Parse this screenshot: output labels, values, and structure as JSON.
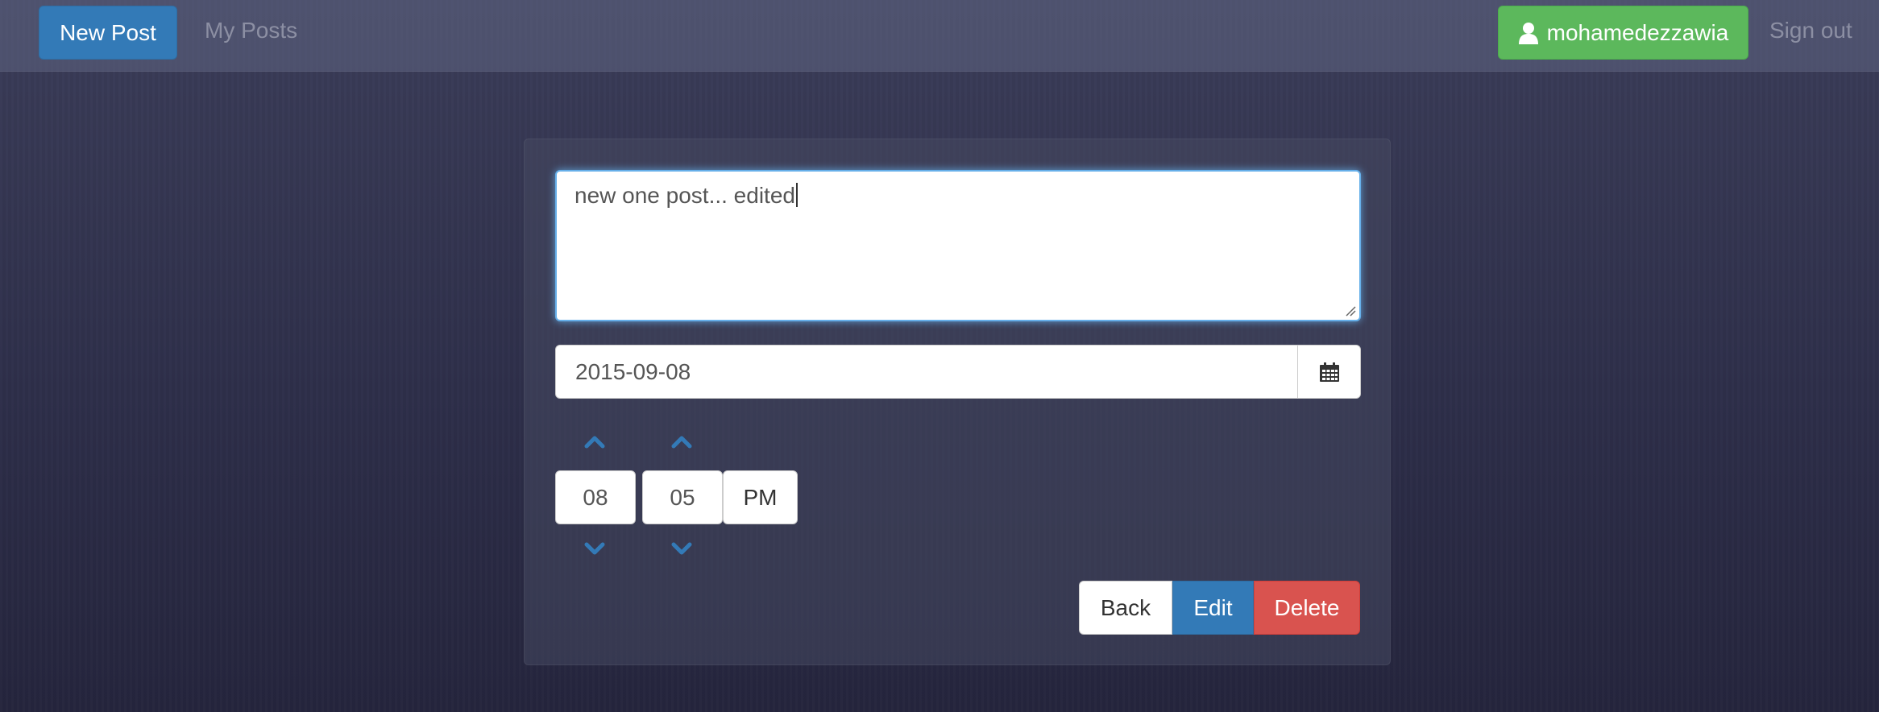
{
  "navbar": {
    "new_post_label": "New Post",
    "my_posts_label": "My Posts",
    "username": "mohamedezzawia",
    "sign_out_label": "Sign out"
  },
  "form": {
    "post_text": "new one post... edited",
    "date_value": "2015-09-08",
    "hour": "08",
    "minute": "05",
    "meridian": "PM"
  },
  "actions": {
    "back_label": "Back",
    "edit_label": "Edit",
    "delete_label": "Delete"
  },
  "icons": {
    "user": "user-icon",
    "calendar": "calendar-icon",
    "chevron_up": "chevron-up-icon",
    "chevron_down": "chevron-down-icon"
  },
  "colors": {
    "primary": "#337ab7",
    "success": "#5cb85c",
    "danger": "#d9534f",
    "focus": "#66afe9"
  }
}
